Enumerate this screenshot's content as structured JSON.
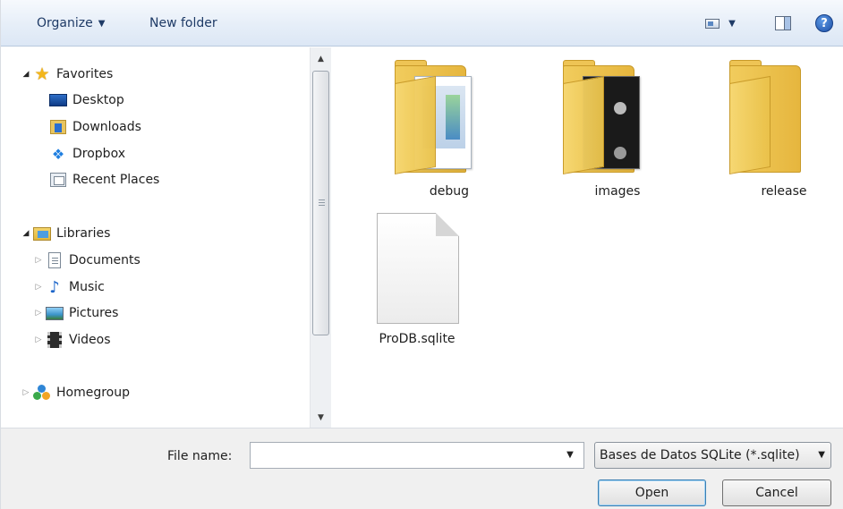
{
  "toolbar": {
    "organize_label": "Organize",
    "new_folder_label": "New folder",
    "help_glyph": "?"
  },
  "sidebar": {
    "items": [
      {
        "label": "Favorites",
        "icon": "star-icon"
      },
      {
        "label": "Desktop",
        "icon": "desktop-icon"
      },
      {
        "label": "Downloads",
        "icon": "downloads-icon"
      },
      {
        "label": "Dropbox",
        "icon": "dropbox-icon"
      },
      {
        "label": "Recent Places",
        "icon": "recent-places-icon"
      },
      {
        "label": "Libraries",
        "icon": "libraries-icon"
      },
      {
        "label": "Documents",
        "icon": "documents-icon"
      },
      {
        "label": "Music",
        "icon": "music-icon"
      },
      {
        "label": "Pictures",
        "icon": "pictures-icon"
      },
      {
        "label": "Videos",
        "icon": "videos-icon"
      },
      {
        "label": "Homegroup",
        "icon": "homegroup-icon"
      }
    ]
  },
  "content": {
    "items": [
      {
        "name": "debug",
        "type": "folder"
      },
      {
        "name": "images",
        "type": "folder"
      },
      {
        "name": "release",
        "type": "folder"
      },
      {
        "name": "ProDB.sqlite",
        "type": "file"
      }
    ]
  },
  "footer": {
    "file_name_label": "File name:",
    "file_name_value": "",
    "file_type": "Bases de Datos SQLite (*.sqlite)",
    "open_label": "Open",
    "cancel_label": "Cancel"
  }
}
